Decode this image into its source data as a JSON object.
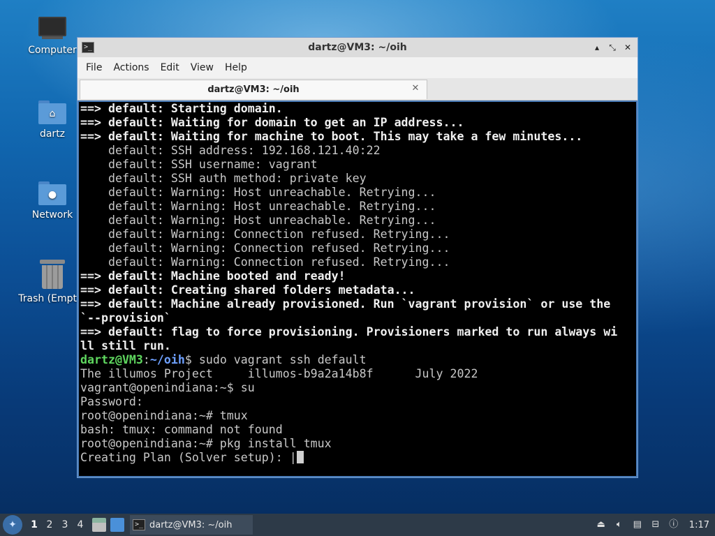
{
  "desktop": {
    "icons": [
      {
        "label": "Computer",
        "icon": "computer-icon"
      },
      {
        "label": "dartz",
        "icon": "home-folder-icon"
      },
      {
        "label": "Network",
        "icon": "network-folder-icon"
      },
      {
        "label": "Trash (Empty)",
        "icon": "trash-icon"
      }
    ]
  },
  "window": {
    "title": "dartz@VM3: ~/oih",
    "menus": [
      "File",
      "Actions",
      "Edit",
      "View",
      "Help"
    ],
    "tab_title": "dartz@VM3: ~/oih",
    "controls": {
      "minimize": "▴",
      "maximize": "⤡",
      "close": "✕"
    }
  },
  "terminal": {
    "lines": [
      {
        "segments": [
          {
            "t": "==> default: Starting domain.",
            "c": "b"
          }
        ]
      },
      {
        "segments": [
          {
            "t": "==> default: Waiting for domain to get an IP address...",
            "c": "b"
          }
        ]
      },
      {
        "segments": [
          {
            "t": "==> default: Waiting for machine to boot. This may take a few minutes...",
            "c": "b"
          }
        ]
      },
      {
        "segments": [
          {
            "t": "    default: SSH address: 192.168.121.40:22",
            "c": ""
          }
        ]
      },
      {
        "segments": [
          {
            "t": "    default: SSH username: vagrant",
            "c": ""
          }
        ]
      },
      {
        "segments": [
          {
            "t": "    default: SSH auth method: private key",
            "c": ""
          }
        ]
      },
      {
        "segments": [
          {
            "t": "    default: Warning: Host unreachable. Retrying...",
            "c": ""
          }
        ]
      },
      {
        "segments": [
          {
            "t": "    default: Warning: Host unreachable. Retrying...",
            "c": ""
          }
        ]
      },
      {
        "segments": [
          {
            "t": "    default: Warning: Host unreachable. Retrying...",
            "c": ""
          }
        ]
      },
      {
        "segments": [
          {
            "t": "    default: Warning: Connection refused. Retrying...",
            "c": ""
          }
        ]
      },
      {
        "segments": [
          {
            "t": "    default: Warning: Connection refused. Retrying...",
            "c": ""
          }
        ]
      },
      {
        "segments": [
          {
            "t": "    default: Warning: Connection refused. Retrying...",
            "c": ""
          }
        ]
      },
      {
        "segments": [
          {
            "t": "==> default: Machine booted and ready!",
            "c": "b"
          }
        ]
      },
      {
        "segments": [
          {
            "t": "==> default: Creating shared folders metadata...",
            "c": "b"
          }
        ]
      },
      {
        "segments": [
          {
            "t": "==> default: Machine already provisioned. Run `vagrant provision` or use the",
            "c": "b"
          }
        ]
      },
      {
        "segments": [
          {
            "t": "`--provision`",
            "c": "b"
          }
        ]
      },
      {
        "segments": [
          {
            "t": "==> default: flag to force provisioning. Provisioners marked to run always wi",
            "c": "b"
          }
        ]
      },
      {
        "segments": [
          {
            "t": "ll still run.",
            "c": "b"
          }
        ]
      },
      {
        "segments": [
          {
            "t": "dartz@VM3",
            "c": "g"
          },
          {
            "t": ":",
            "c": ""
          },
          {
            "t": "~/oih",
            "c": "bl"
          },
          {
            "t": "$ sudo vagrant ssh default",
            "c": ""
          }
        ]
      },
      {
        "segments": [
          {
            "t": "The illumos Project     illumos-b9a2a14b8f      July 2022",
            "c": ""
          }
        ]
      },
      {
        "segments": [
          {
            "t": "vagrant@openindiana:~$ su",
            "c": ""
          }
        ]
      },
      {
        "segments": [
          {
            "t": "Password:",
            "c": ""
          }
        ]
      },
      {
        "segments": [
          {
            "t": "root@openindiana:~# tmux",
            "c": ""
          }
        ]
      },
      {
        "segments": [
          {
            "t": "bash: tmux: command not found",
            "c": ""
          }
        ]
      },
      {
        "segments": [
          {
            "t": "root@openindiana:~# pkg install tmux",
            "c": ""
          }
        ]
      },
      {
        "segments": [
          {
            "t": "Creating Plan (Solver setup): |",
            "c": ""
          }
        ],
        "cursor": true
      }
    ]
  },
  "taskbar": {
    "workspaces": [
      "1",
      "2",
      "3",
      "4"
    ],
    "active_workspace": "1",
    "task_label": "dartz@VM3: ~/oih",
    "clock": "1:17",
    "tray_icons": [
      "eject-icon",
      "volume-icon",
      "clipboard-icon",
      "network-icon",
      "notification-icon"
    ]
  }
}
